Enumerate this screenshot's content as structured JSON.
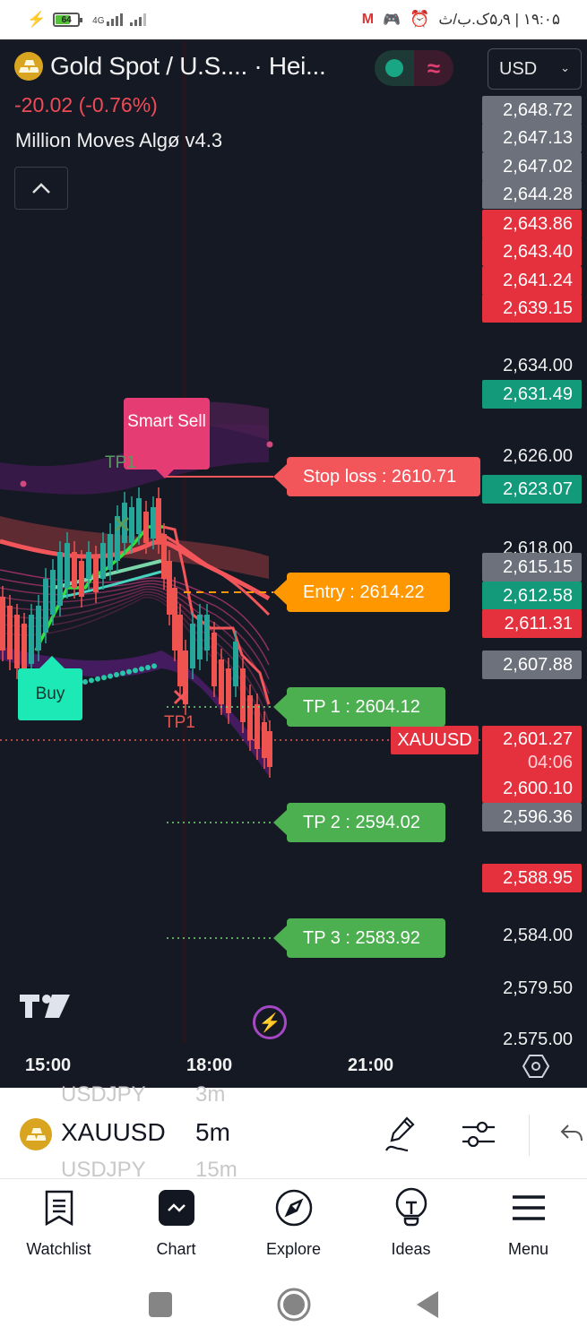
{
  "status_bar": {
    "battery": "64",
    "network": "4G",
    "time_text": "۱۹:۰۵ | ۵٫۹ک.ب/ث",
    "icons": [
      "charging-bolt-icon",
      "battery-icon",
      "signal-4g-icon",
      "signal-icon",
      "gmail-icon",
      "game-controller-icon",
      "alarm-icon"
    ]
  },
  "chart_header": {
    "title": "Gold Spot / U.S.... · Hei...",
    "change": "-20.02 (-0.76%)",
    "indicator_name": "Million Moves Algø v4.3",
    "currency": "USD",
    "mode_toggle": {
      "live_icon": "green-dot-icon",
      "wave_icon": "≈"
    }
  },
  "price_axis": {
    "labels": [
      {
        "value": "2,648.72",
        "style": "gray"
      },
      {
        "value": "2,647.13",
        "style": "gray"
      },
      {
        "value": "2,647.02",
        "style": "gray"
      },
      {
        "value": "2,644.28",
        "style": "gray"
      },
      {
        "value": "2,643.86",
        "style": "red"
      },
      {
        "value": "2,643.40",
        "style": "red"
      },
      {
        "value": "2,641.24",
        "style": "red"
      },
      {
        "value": "2,639.15",
        "style": "red"
      },
      {
        "value": "2,634.00",
        "style": "plain"
      },
      {
        "value": "2,631.49",
        "style": "green"
      },
      {
        "value": "2,626.00",
        "style": "plain"
      },
      {
        "value": "2,623.07",
        "style": "green"
      },
      {
        "value": "2,618.00",
        "style": "plain"
      },
      {
        "value": "2,615.15",
        "style": "gray"
      },
      {
        "value": "2,612.58",
        "style": "green"
      },
      {
        "value": "2,611.31",
        "style": "red"
      },
      {
        "value": "2,607.88",
        "style": "gray"
      },
      {
        "value": "2,600.10",
        "style": "red"
      },
      {
        "value": "2,596.36",
        "style": "gray"
      },
      {
        "value": "2,588.95",
        "style": "red"
      },
      {
        "value": "2,584.00",
        "style": "plain"
      },
      {
        "value": "2,579.50",
        "style": "plain"
      },
      {
        "value": "2,575.00",
        "style": "plain"
      }
    ],
    "current": {
      "symbol": "XAUUSD",
      "price": "2,601.27",
      "countdown": "04:06"
    }
  },
  "time_axis": {
    "labels": [
      "15:00",
      "18:00",
      "21:00"
    ]
  },
  "signals": {
    "smart_sell": "Smart Sell",
    "buy": "Buy",
    "tp1_green": "TP1",
    "tp1_red": "TP1",
    "stop_loss": "Stop loss : 2610.71",
    "entry": "Entry : 2614.22",
    "tp1": "TP 1 : 2604.12",
    "tp2": "TP 2 : 2594.02",
    "tp3": "TP 3 : 2583.92"
  },
  "colors": {
    "background": "#151924",
    "up": "#26a69a",
    "down": "#ef5350",
    "stop_loss": "#f2565a",
    "entry": "#ff9800",
    "take_profit": "#4caf50",
    "buy": "#1de9b6",
    "smart_sell": "#e63c74"
  },
  "symbol_bar": {
    "prev_symbol": "USDJPY",
    "prev_tf": "3m",
    "symbol": "XAUUSD",
    "timeframe": "5m",
    "next_symbol": "USDJPY",
    "next_tf": "15m"
  },
  "bottom_nav": [
    {
      "label": "Watchlist",
      "icon": "watchlist-icon"
    },
    {
      "label": "Chart",
      "icon": "chart-icon",
      "active": true
    },
    {
      "label": "Explore",
      "icon": "compass-icon"
    },
    {
      "label": "Ideas",
      "icon": "lightbulb-icon"
    },
    {
      "label": "Menu",
      "icon": "menu-icon"
    }
  ]
}
